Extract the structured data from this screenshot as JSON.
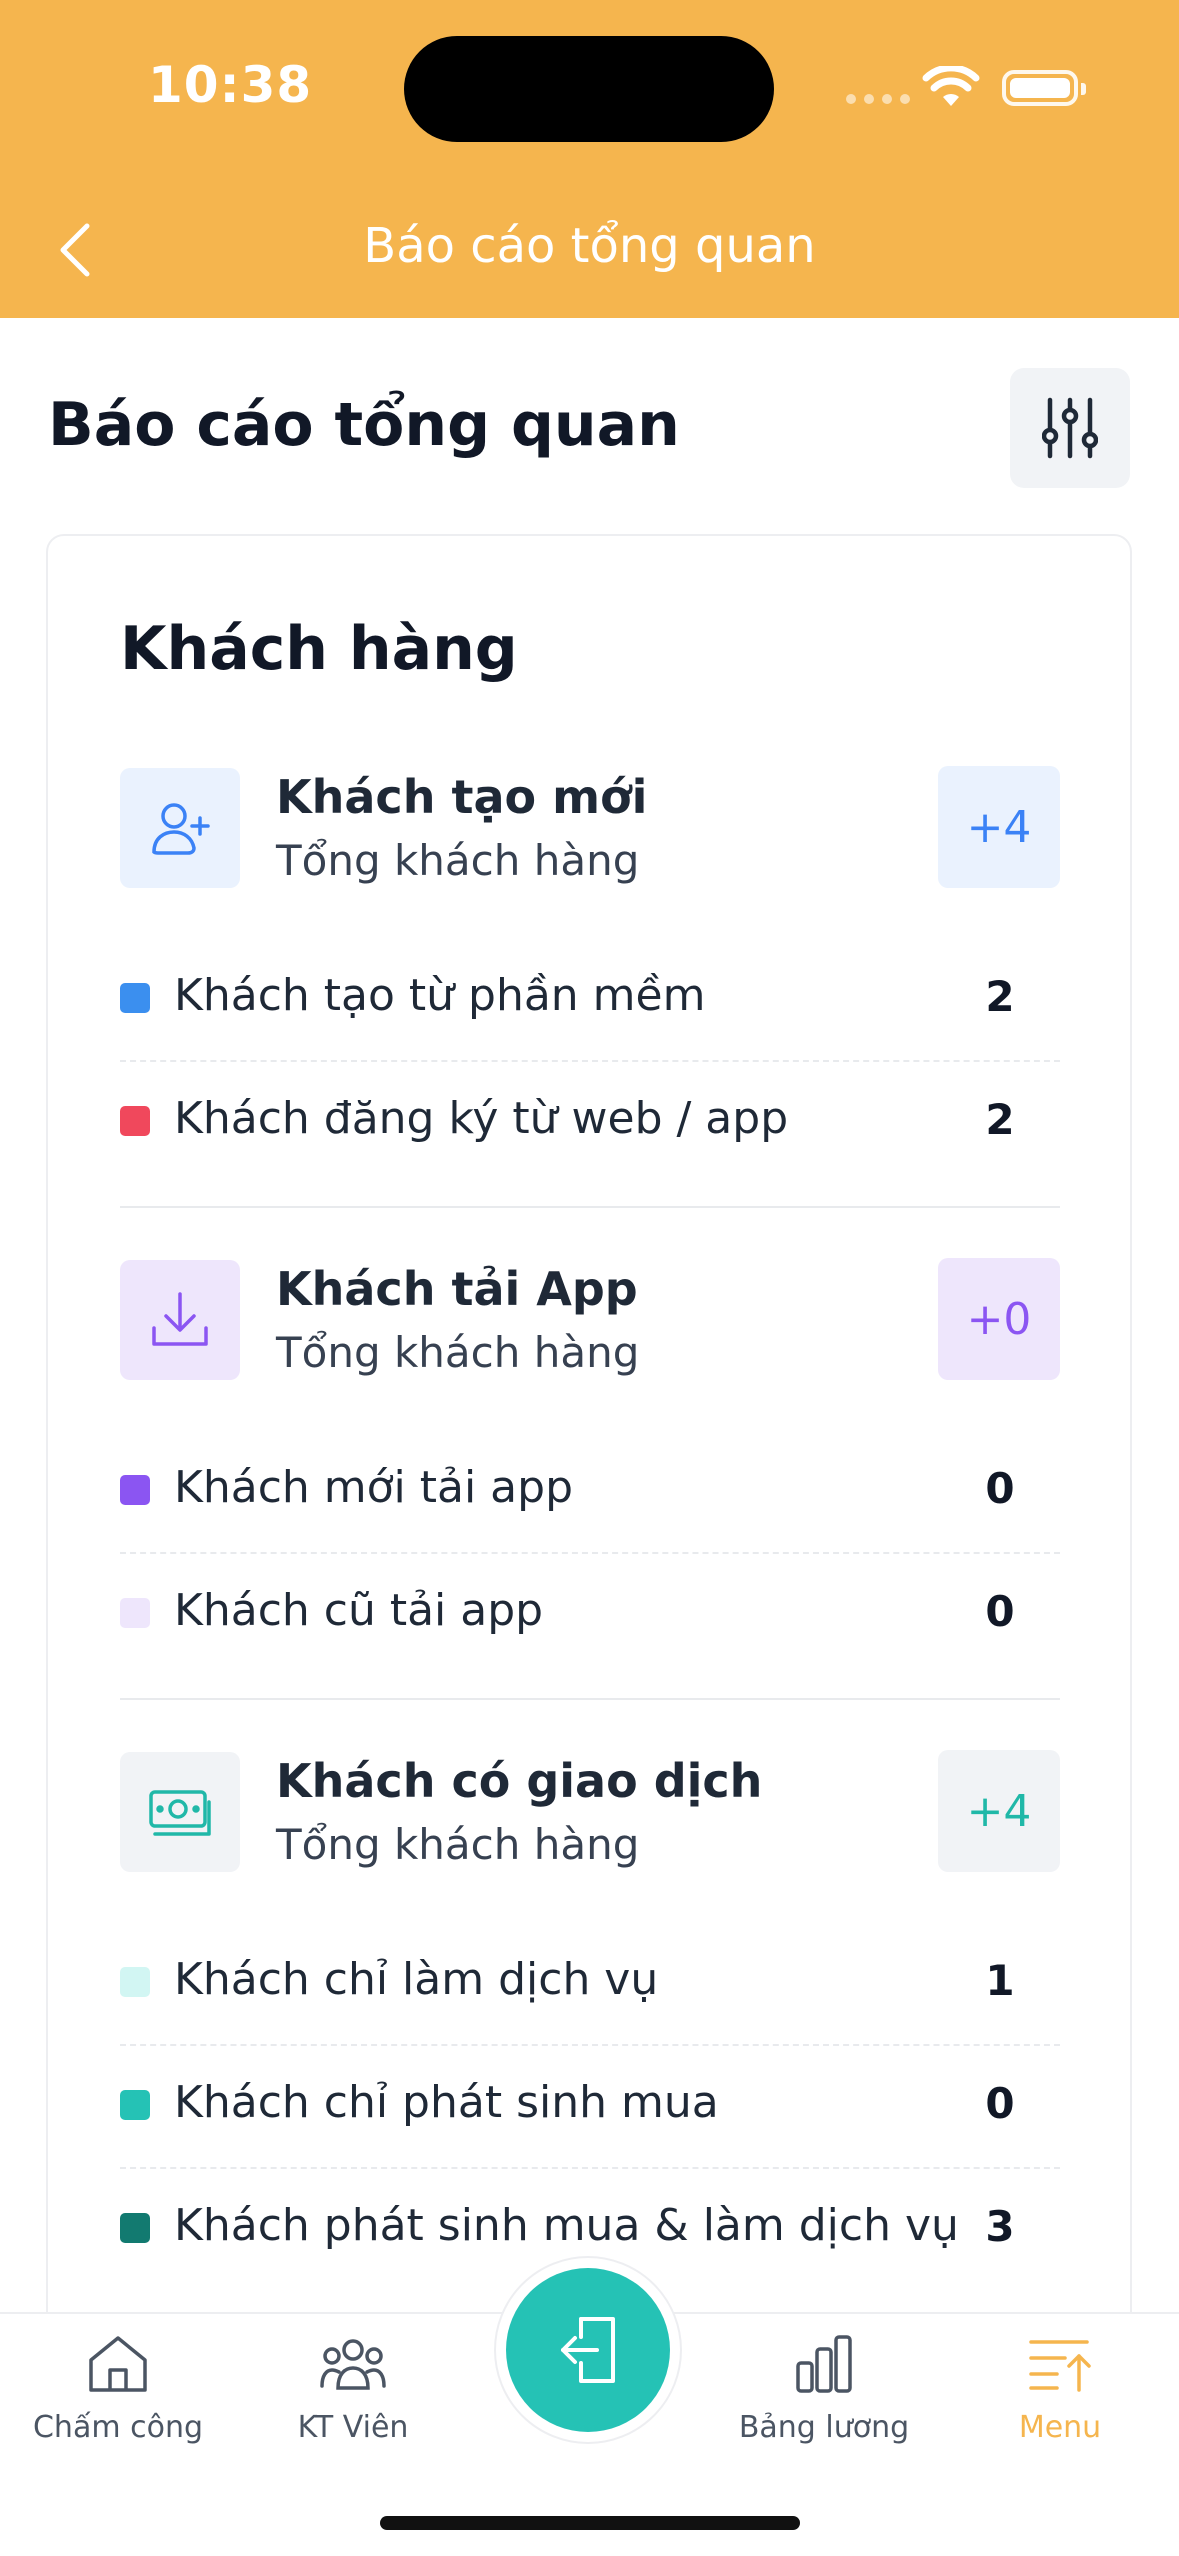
{
  "status_bar": {
    "time": "10:38"
  },
  "nav": {
    "title": "Báo cáo tổng quan"
  },
  "page": {
    "title": "Báo cáo tổng quan"
  },
  "card": {
    "title": "Khách hàng",
    "groups": [
      {
        "title": "Khách tạo mới",
        "subtitle": "Tổng khách hàng",
        "badge": "+4",
        "icon": "user-plus-icon",
        "color": "#3B82F6",
        "rows": [
          {
            "label": "Khách tạo từ phần mềm",
            "value": "2",
            "color": "#3B8FEF"
          },
          {
            "label": "Khách đăng ký từ web / app",
            "value": "2",
            "color": "#F0485C"
          }
        ]
      },
      {
        "title": "Khách tải App",
        "subtitle": "Tổng khách hàng",
        "badge": "+0",
        "icon": "download-icon",
        "color": "#8B5CF6",
        "rows": [
          {
            "label": "Khách mới tải app",
            "value": "0",
            "color": "#8B55F2"
          },
          {
            "label": "Khách cũ tải app",
            "value": "0",
            "color": "#EEE6FC"
          }
        ]
      },
      {
        "title": "Khách có giao dịch",
        "subtitle": "Tổng khách hàng",
        "badge": "+4",
        "icon": "money-icon",
        "color": "#20B8A8",
        "rows": [
          {
            "label": "Khách chỉ làm dịch vụ",
            "value": "1",
            "color": "#D2F6F3"
          },
          {
            "label": "Khách chỉ phát sinh mua",
            "value": "0",
            "color": "#25C2B5"
          },
          {
            "label": "Khách phát sinh mua & làm dịch vụ",
            "value": "3",
            "color": "#127A70"
          }
        ]
      }
    ]
  },
  "bottom_nav": {
    "tabs": [
      {
        "label": "Chấm công",
        "icon": "home-icon"
      },
      {
        "label": "KT Viên",
        "icon": "users-icon"
      },
      {
        "label": "Bảng lương",
        "icon": "bar-chart-icon"
      },
      {
        "label": "Menu",
        "icon": "menu-sort-icon",
        "active": true
      }
    ],
    "center_icon": "check-in-icon"
  },
  "colors": {
    "header": "#F5B54E",
    "accent_teal": "#25C2B5"
  }
}
